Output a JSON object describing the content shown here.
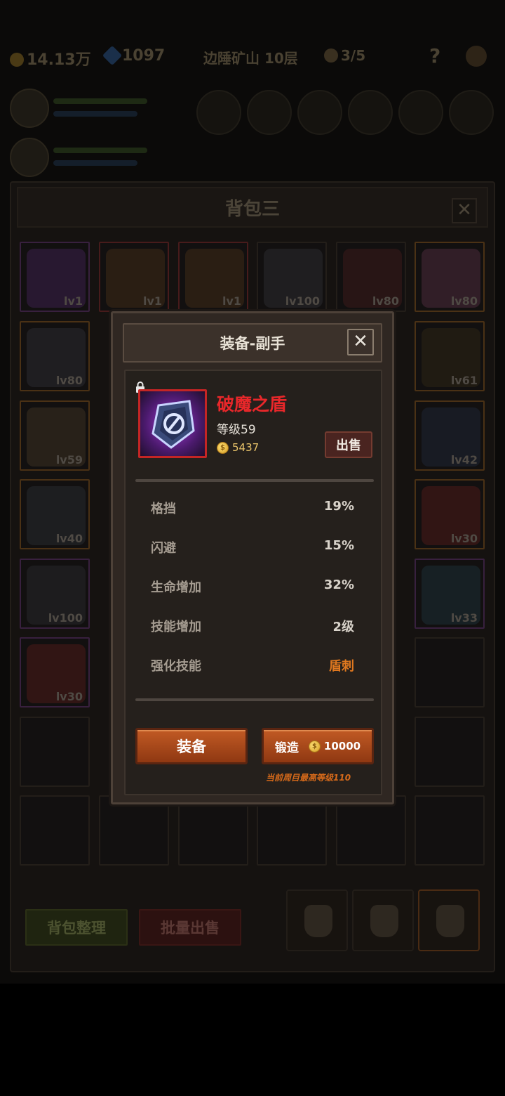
{
  "topbar": {
    "gold": "14.13万",
    "gems": "1097",
    "location": "边陲矿山 10层",
    "keys": "3/5",
    "help": "?"
  },
  "bag": {
    "title": "背包三",
    "close": "✕",
    "slots": [
      {
        "lv": "lv1",
        "rarity": "purple",
        "color": "#3a1f4a"
      },
      {
        "lv": "lv1",
        "rarity": "red",
        "color": "#3e2a16"
      },
      {
        "lv": "lv1",
        "rarity": "red",
        "color": "#3e2a16"
      },
      {
        "lv": "lv100",
        "rarity": "none",
        "color": "#2a2a2e"
      },
      {
        "lv": "lv80",
        "rarity": "none",
        "color": "#3a1a1a"
      },
      {
        "lv": "lv80",
        "rarity": "orange",
        "color": "#4a2a3a"
      },
      {
        "lv": "lv80",
        "rarity": "orange",
        "color": "#2a2a30"
      },
      {
        "lv": "lv61",
        "rarity": "orange",
        "color": "#2c2414"
      },
      {
        "lv": "lv59",
        "rarity": "orange",
        "color": "#3a3020"
      },
      {
        "lv": "lv42",
        "rarity": "orange",
        "color": "#1e2433"
      },
      {
        "lv": "lv40",
        "rarity": "orange",
        "color": "#262a2e"
      },
      {
        "lv": "lv30",
        "rarity": "orange",
        "color": "#4a1a18"
      },
      {
        "lv": "lv100",
        "rarity": "purple",
        "color": "#26262a"
      },
      {
        "lv": "lv33",
        "rarity": "purple",
        "color": "#1c2e34"
      },
      {
        "lv": "lv30",
        "rarity": "purple",
        "color": "#4a1a18"
      }
    ],
    "sort_button": "背包整理",
    "bulk_sell_button": "批量出售"
  },
  "modal": {
    "title": "装备-副手",
    "close": "✕",
    "item_name": "破魔之盾",
    "item_level": "等级59",
    "item_price": "5437",
    "sell_button": "出售",
    "stats": [
      {
        "name": "格挡",
        "value": "19%"
      },
      {
        "name": "闪避",
        "value": "15%"
      },
      {
        "name": "生命增加",
        "value": "32%"
      },
      {
        "name": "技能增加",
        "value": "2级"
      },
      {
        "name": "强化技能",
        "value": "盾刺"
      }
    ],
    "equip_button": "装备",
    "forge_button": "锻造",
    "forge_cost": "10000",
    "forge_note": "当前周目最高等级110"
  }
}
